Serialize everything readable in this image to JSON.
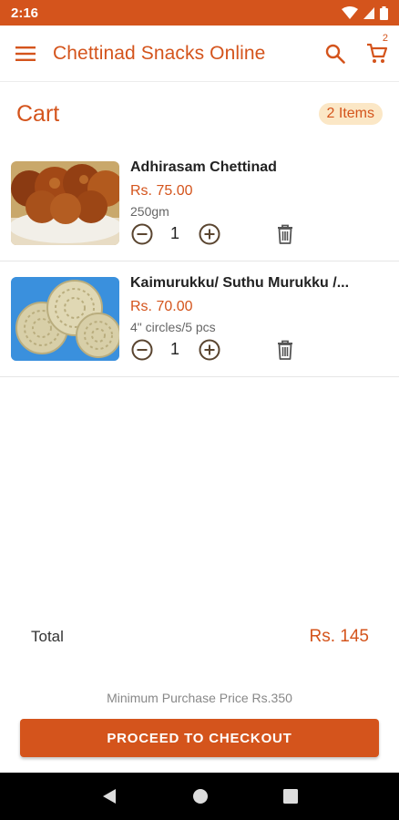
{
  "status_bar": {
    "time": "2:16"
  },
  "app_bar": {
    "title": "Chettinad Snacks Online",
    "cart_count": "2"
  },
  "cart": {
    "title": "Cart",
    "items_badge": "2 Items"
  },
  "items": [
    {
      "name": "Adhirasam Chettinad",
      "price": "Rs. 75.00",
      "variant": "250gm",
      "quantity": "1",
      "image": "adhirasam-photo"
    },
    {
      "name": "Kaimurukku/ Suthu Murukku /...",
      "price": "Rs. 70.00",
      "variant": "4\" circles/5 pcs",
      "quantity": "1",
      "image": "murukku-photo"
    }
  ],
  "summary": {
    "total_label": "Total",
    "total_value": "Rs. 145",
    "min_purchase": "Minimum Purchase Price Rs.350"
  },
  "checkout": {
    "label": "PROCEED TO CHECKOUT"
  },
  "colors": {
    "accent": "#d4541c",
    "badge_bg": "#fbe7c6",
    "nav_bar": "#000000"
  }
}
